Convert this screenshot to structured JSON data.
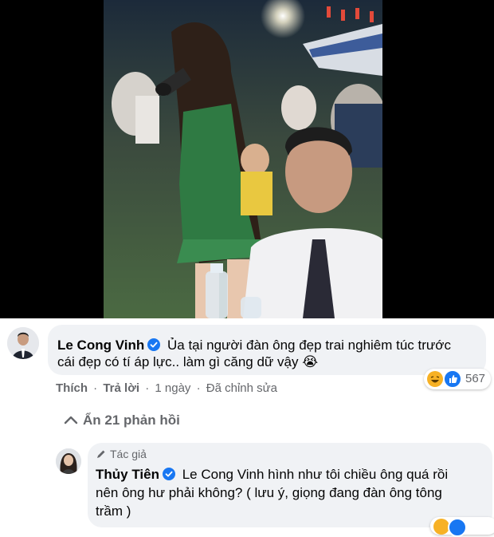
{
  "comment": {
    "author": "Le Cong Vinh",
    "text_line1": "Ủa tại người đàn ông đẹp trai nghiêm túc trước",
    "text_line2": "cái đẹp có tí áp lực.. làm gì căng dữ vậy",
    "emoji": "😭",
    "actions": {
      "like": "Thích",
      "reply": "Trả lời",
      "time": "1 ngày",
      "edited": "Đã chỉnh sửa",
      "separator": "·"
    },
    "reaction_count": "567",
    "reaction_icons": [
      "haha-icon",
      "like-icon"
    ]
  },
  "hide_replies": {
    "label": "Ẩn 21 phản hồi"
  },
  "reply": {
    "badge": "Tác giả",
    "author": "Thủy Tiên",
    "mention": "Le Cong Vinh",
    "text_line1_rest": "hình như tôi chiều ông quá rồi",
    "text_line2": "nên ông hư phải không? ( lưu ý, giọng đang đàn ông tông",
    "text_line3": "trầm )"
  },
  "colors": {
    "bubble": "#f0f2f5",
    "secondary_text": "#65676b",
    "primary_text": "#050505",
    "verified": "#1877f2",
    "like_blue": "#1877f2",
    "haha_yellow": "#f7b125"
  }
}
